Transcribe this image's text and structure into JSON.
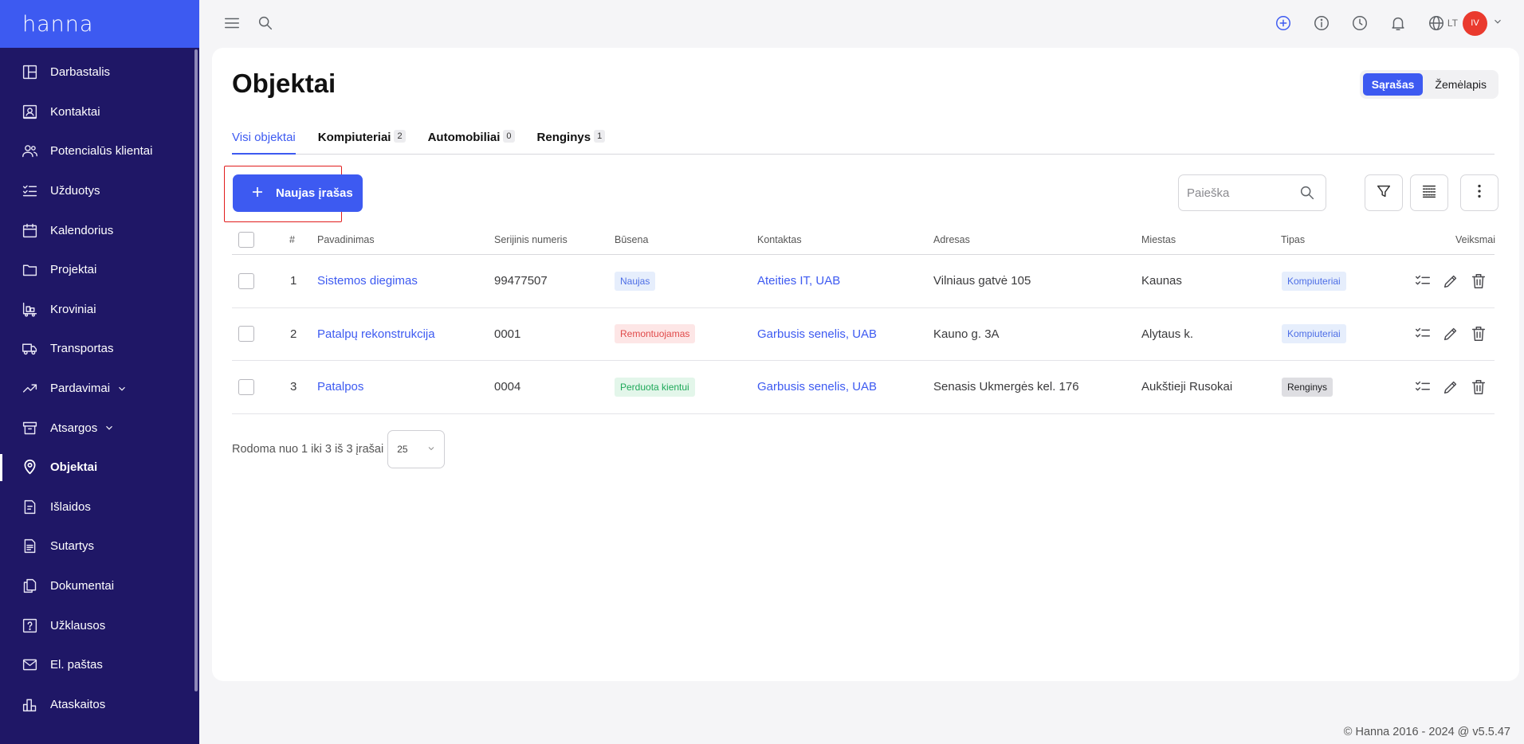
{
  "app": {
    "logo": "hanna"
  },
  "sidebar": {
    "items": [
      {
        "label": "Darbastalis",
        "icon": "dashboard-icon"
      },
      {
        "label": "Kontaktai",
        "icon": "contact-card-icon"
      },
      {
        "label": "Potencialūs klientai",
        "icon": "people-icon"
      },
      {
        "label": "Užduotys",
        "icon": "checklist-icon"
      },
      {
        "label": "Kalendorius",
        "icon": "calendar-icon"
      },
      {
        "label": "Projektai",
        "icon": "folder-icon"
      },
      {
        "label": "Kroviniai",
        "icon": "cargo-icon"
      },
      {
        "label": "Transportas",
        "icon": "truck-icon"
      },
      {
        "label": "Pardavimai",
        "icon": "trend-icon"
      },
      {
        "label": "Atsargos",
        "icon": "archive-icon"
      },
      {
        "label": "Objektai",
        "icon": "location-pin-icon"
      },
      {
        "label": "Išlaidos",
        "icon": "receipt-icon"
      },
      {
        "label": "Sutartys",
        "icon": "contract-icon"
      },
      {
        "label": "Dokumentai",
        "icon": "documents-icon"
      },
      {
        "label": "Užklausos",
        "icon": "question-icon"
      },
      {
        "label": "El. paštas",
        "icon": "mail-icon"
      },
      {
        "label": "Ataskaitos",
        "icon": "bar-chart-icon"
      }
    ]
  },
  "topbar": {
    "lang": "LT",
    "avatar_initials": "IV"
  },
  "page": {
    "title": "Objektai",
    "view_list": "Sąrašas",
    "view_map": "Žemėlapis"
  },
  "tabs": [
    {
      "label": "Visi objektai",
      "count": ""
    },
    {
      "label": "Kompiuteriai",
      "count": "2"
    },
    {
      "label": "Automobiliai",
      "count": "0"
    },
    {
      "label": "Renginys",
      "count": "1"
    }
  ],
  "toolbar": {
    "new_label": "Naujas įrašas",
    "search_placeholder": "Paieška"
  },
  "table": {
    "headers": {
      "num": "#",
      "name": "Pavadinimas",
      "serial": "Serijinis numeris",
      "status": "Būsena",
      "contact": "Kontaktas",
      "address": "Adresas",
      "city": "Miestas",
      "type": "Tipas",
      "actions": "Veiksmai"
    },
    "rows": [
      {
        "num": "1",
        "name": "Sistemos diegimas",
        "serial": "99477507",
        "status": "Naujas",
        "contact": "Ateities IT, UAB",
        "address": "Vilniaus gatvė 105",
        "city": "Kaunas",
        "type": "Kompiuteriai"
      },
      {
        "num": "2",
        "name": "Patalpų rekonstrukcija",
        "serial": "0001",
        "status": "Remontuojamas",
        "contact": "Garbusis senelis, UAB",
        "address": "Kauno g. 3A",
        "city": "Alytaus k.",
        "type": "Kompiuteriai"
      },
      {
        "num": "3",
        "name": "Patalpos",
        "serial": "0004",
        "status": "Perduota kientui",
        "contact": "Garbusis senelis, UAB",
        "address": "Senasis Ukmergės kel. 176",
        "city": "Aukštieji Rusokai",
        "type": "Renginys"
      }
    ]
  },
  "pager": {
    "text": "Rodoma nuo 1 iki 3 iš 3 įrašai",
    "page_size": "25"
  },
  "footer": {
    "text": "© Hanna 2016 - 2024 @ v5.5.47"
  },
  "colors": {
    "accent": "#3d5af1",
    "sidebar": "#1f1766",
    "highlight": "#e11d1d"
  }
}
